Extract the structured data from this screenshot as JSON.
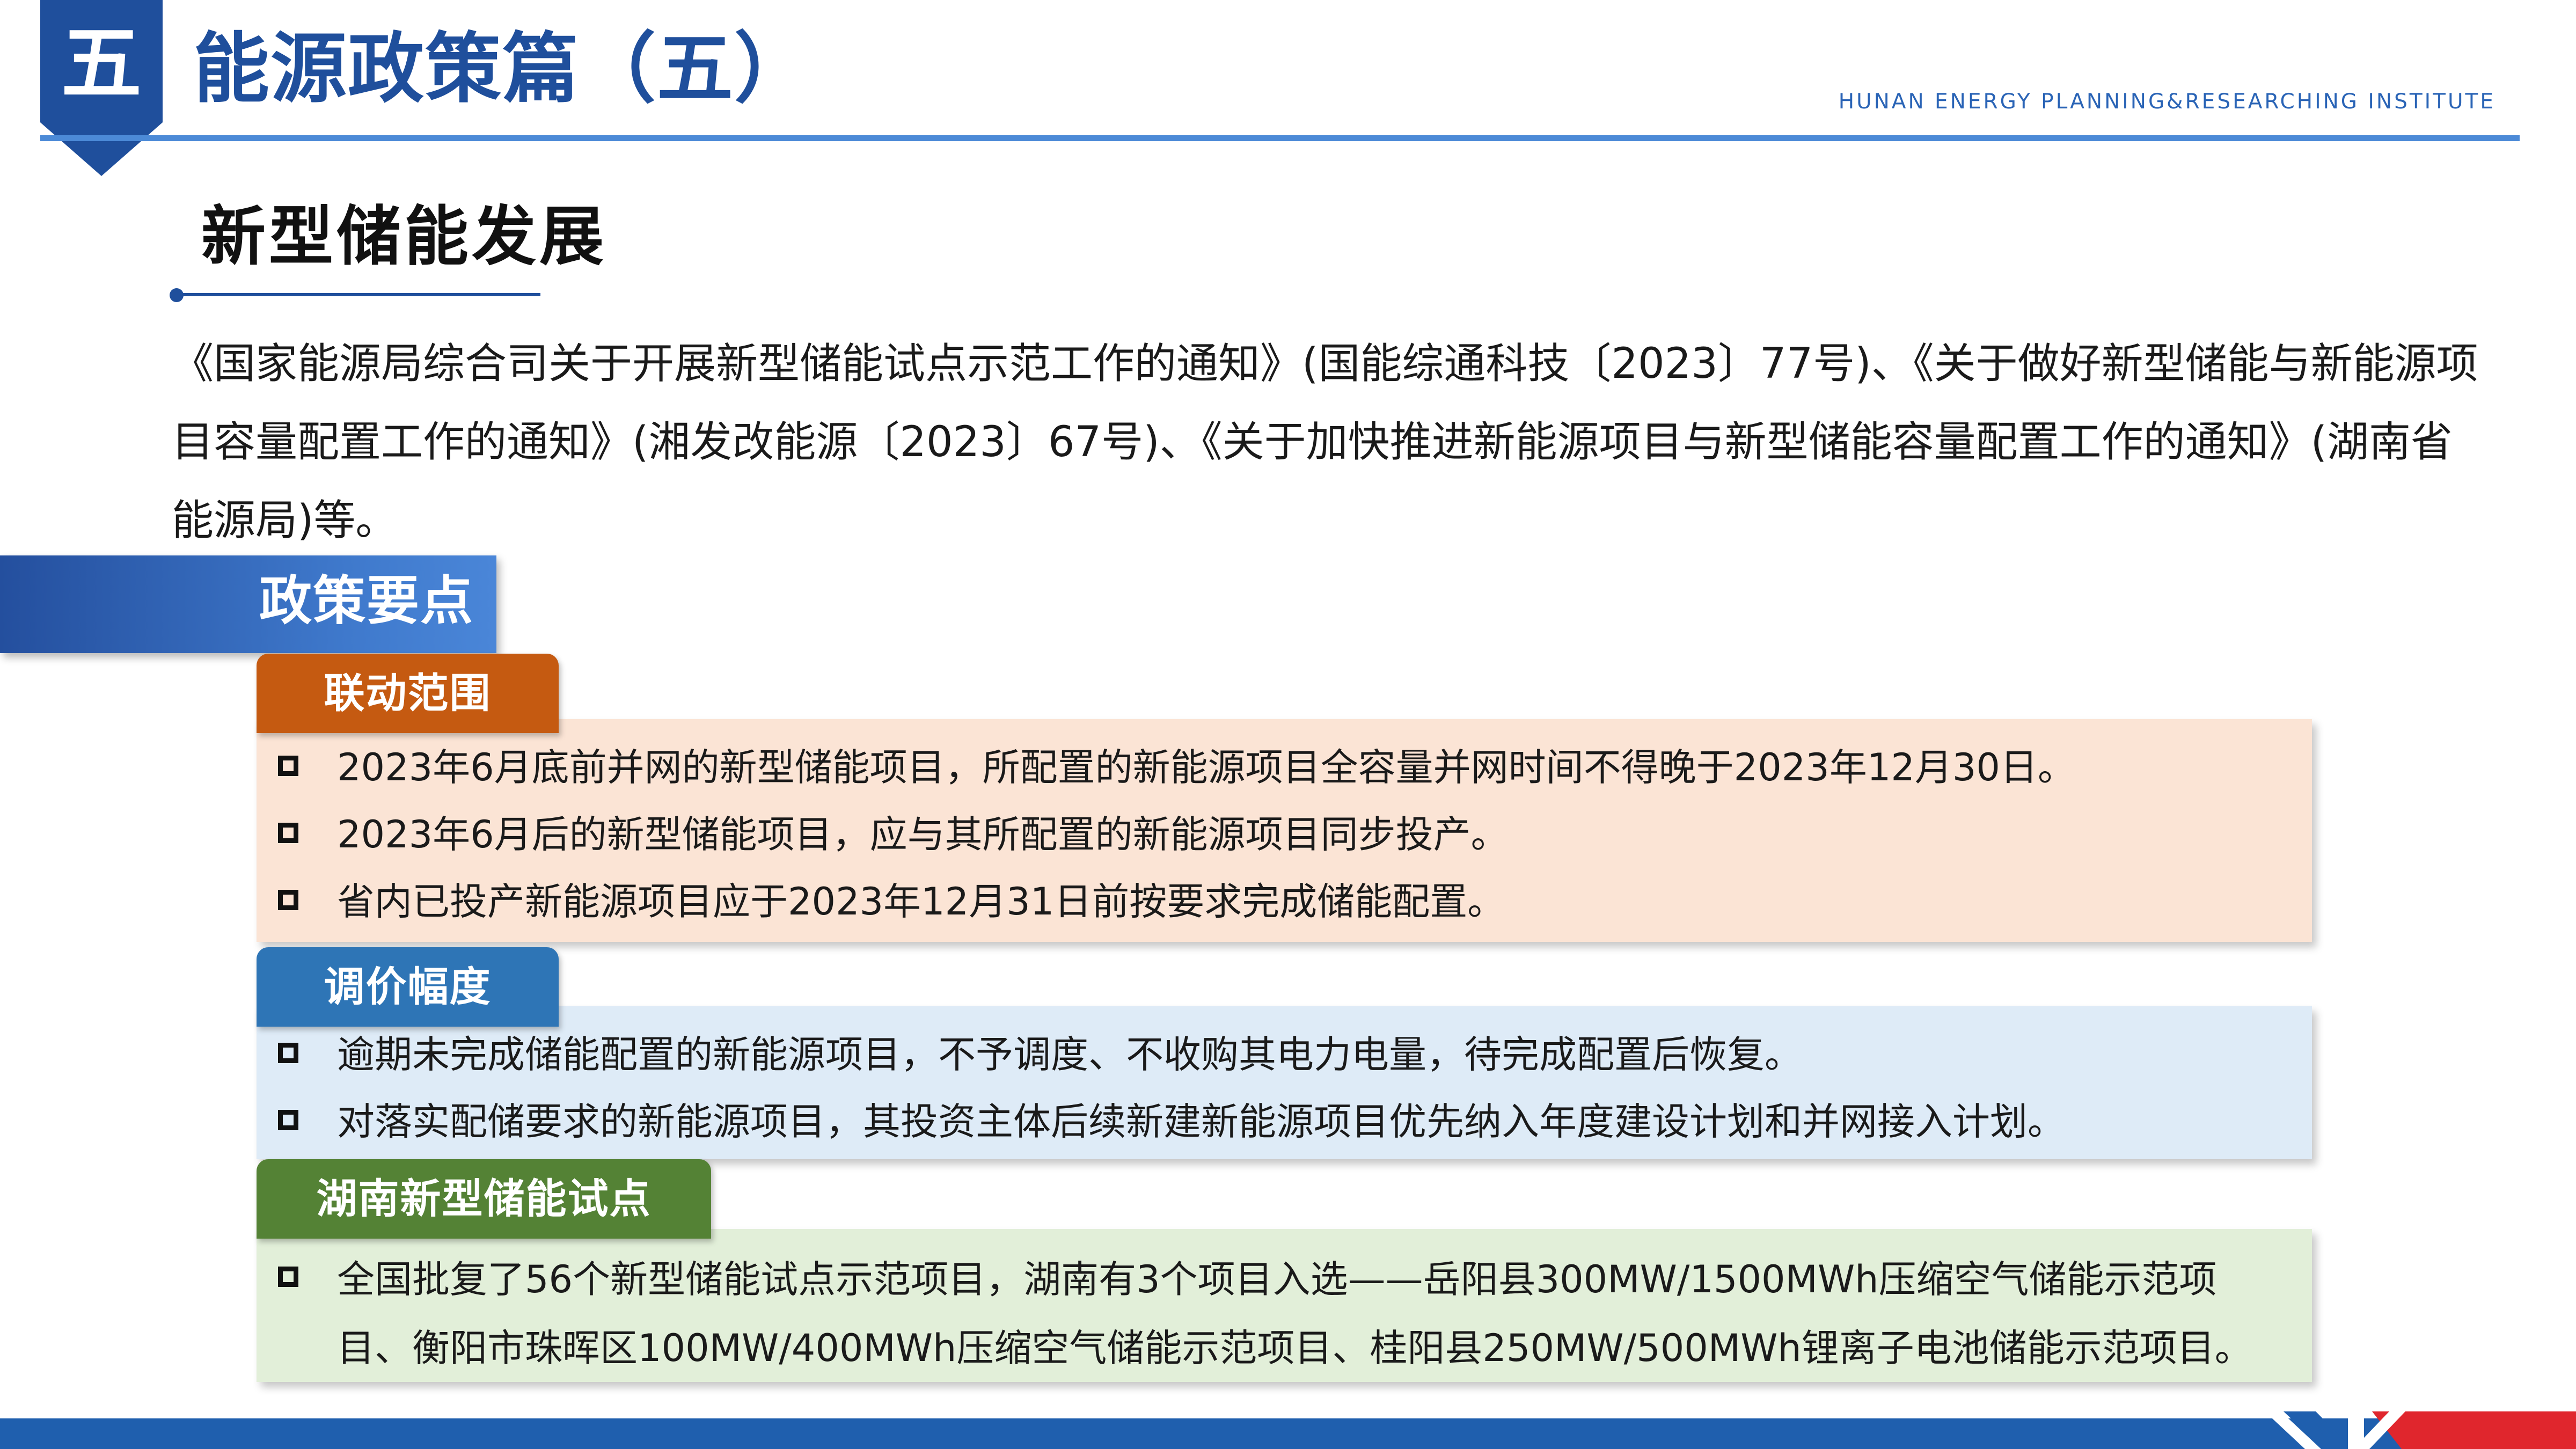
{
  "header": {
    "chapter_number": "五",
    "title": "能源政策篇（五）",
    "subtitle": "HUNAN ENERGY PLANNING&RESEARCHING INSTITUTE"
  },
  "section": {
    "title": "新型储能发展"
  },
  "intro": {
    "text": "《国家能源局综合司关于开展新型储能试点示范工作的通知》(国能综通科技〔2023〕77号)、《关于做好新型储能与新能源项目容量配置工作的通知》(湘发改能源〔2023〕67号)、《关于加快推进新能源项目与新型储能容量配置工作的通知》(湖南省能源局)等。"
  },
  "policy_banner": {
    "label": "政策要点"
  },
  "categories": [
    {
      "tag": "联动范围",
      "items": [
        "2023年6月底前并网的新型储能项目，所配置的新能源项目全容量并网时间不得晚于2023年12月30日。",
        "2023年6月后的新型储能项目，应与其所配置的新能源项目同步投产。",
        "省内已投产新能源项目应于2023年12月31日前按要求完成储能配置。"
      ]
    },
    {
      "tag": "调价幅度",
      "items": [
        "逾期未完成储能配置的新能源项目，不予调度、不收购其电力电量，待完成配置后恢复。",
        "对落实配储要求的新能源项目，其投资主体后续新建新能源项目优先纳入年度建设计划和并网接入计划。"
      ]
    },
    {
      "tag": "湖南新型储能试点",
      "items": [
        "全国批复了56个新型储能试点示范项目，湖南有3个项目入选——岳阳县300MW/1500MWh压缩空气储能示范项目、衡阳市珠晖区100MW/400MWh压缩空气储能示范项目、桂阳县250MW/500MWh锂离子电池储能示范项目。"
      ]
    }
  ],
  "colors": {
    "brand_blue": "#1f4f9c",
    "accent_blue": "#4c8ad7",
    "tag_orange": "#c55a11",
    "tag_blue": "#2e75b6",
    "tag_green": "#548235",
    "box_orange": "#fbe4d5",
    "box_blue": "#deebf7",
    "box_green": "#e2efd9",
    "footer_red": "#e0262d"
  }
}
